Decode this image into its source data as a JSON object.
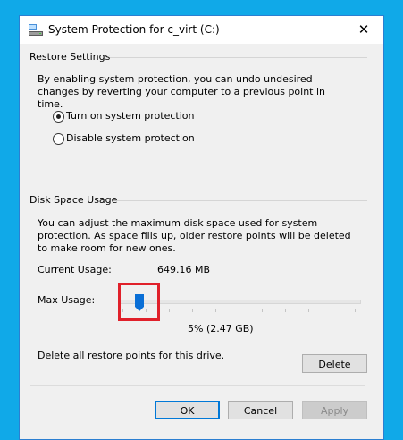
{
  "window": {
    "title": "System Protection for c_virt (C:)",
    "close_symbol": "✕"
  },
  "restore_settings": {
    "group_label": "Restore Settings",
    "description": "By enabling system protection, you can undo undesired changes by reverting your computer to a previous point in time.",
    "options": [
      {
        "label": "Turn on system protection",
        "checked": true
      },
      {
        "label": "Disable system protection",
        "checked": false
      }
    ]
  },
  "disk_space": {
    "group_label": "Disk Space Usage",
    "description": "You can adjust the maximum disk space used for system protection. As space fills up, older restore points will be deleted to make room for new ones.",
    "current_usage_label": "Current Usage:",
    "current_usage_value": "649.16 MB",
    "max_usage_label": "Max Usage:",
    "max_usage_value": "5% (2.47 GB)",
    "slider_fraction": 0.05,
    "delete_text": "Delete all restore points for this drive.",
    "delete_label": "Delete"
  },
  "footer": {
    "ok_label": "OK",
    "cancel_label": "Cancel",
    "apply_label": "Apply"
  },
  "colors": {
    "desktop": "#10a9e8",
    "accent": "#0078d7",
    "highlight": "#e0202a"
  },
  "icons": {
    "title": "system-protection-icon",
    "close": "close-icon"
  }
}
